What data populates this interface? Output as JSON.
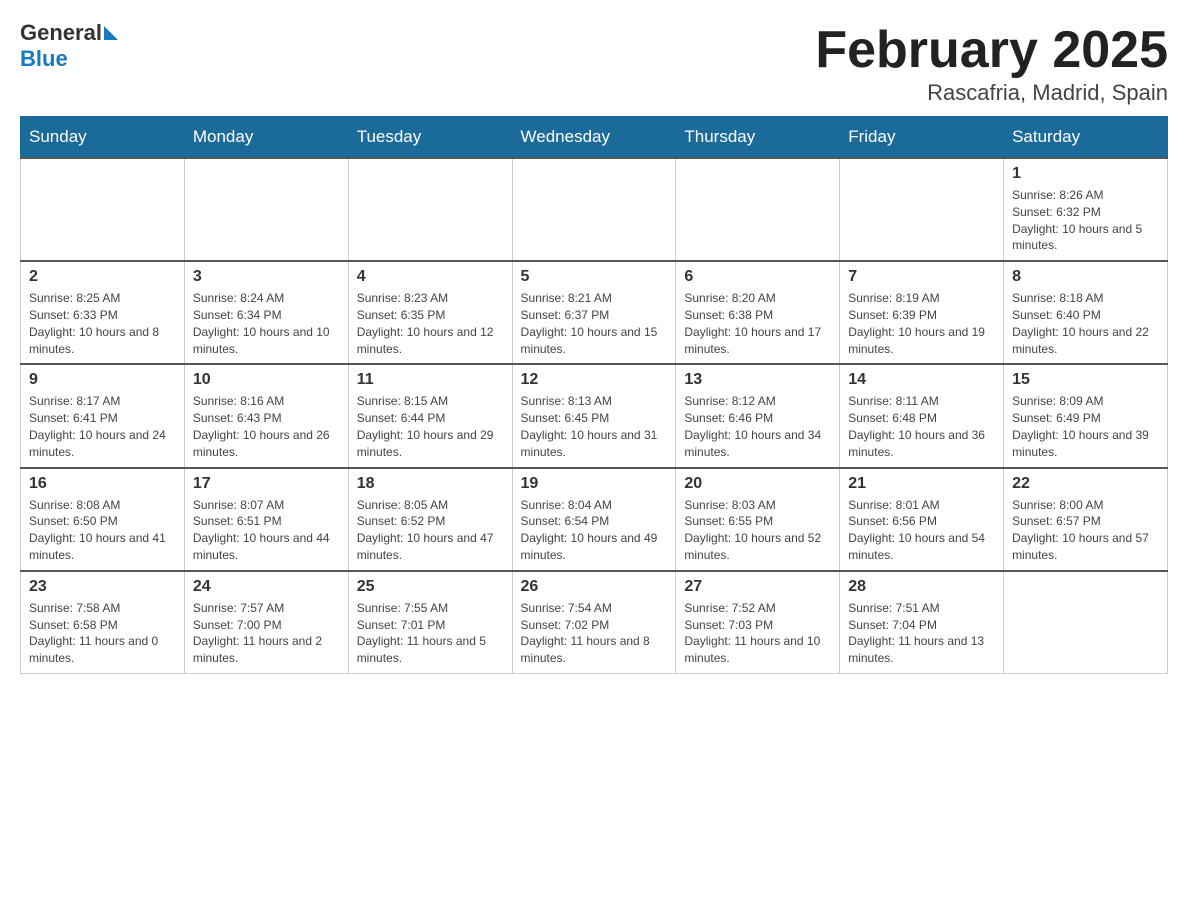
{
  "logo": {
    "general": "General",
    "blue": "Blue"
  },
  "header": {
    "month_year": "February 2025",
    "location": "Rascafria, Madrid, Spain"
  },
  "weekdays": [
    "Sunday",
    "Monday",
    "Tuesday",
    "Wednesday",
    "Thursday",
    "Friday",
    "Saturday"
  ],
  "weeks": [
    [
      {
        "day": "",
        "info": ""
      },
      {
        "day": "",
        "info": ""
      },
      {
        "day": "",
        "info": ""
      },
      {
        "day": "",
        "info": ""
      },
      {
        "day": "",
        "info": ""
      },
      {
        "day": "",
        "info": ""
      },
      {
        "day": "1",
        "info": "Sunrise: 8:26 AM\nSunset: 6:32 PM\nDaylight: 10 hours and 5 minutes."
      }
    ],
    [
      {
        "day": "2",
        "info": "Sunrise: 8:25 AM\nSunset: 6:33 PM\nDaylight: 10 hours and 8 minutes."
      },
      {
        "day": "3",
        "info": "Sunrise: 8:24 AM\nSunset: 6:34 PM\nDaylight: 10 hours and 10 minutes."
      },
      {
        "day": "4",
        "info": "Sunrise: 8:23 AM\nSunset: 6:35 PM\nDaylight: 10 hours and 12 minutes."
      },
      {
        "day": "5",
        "info": "Sunrise: 8:21 AM\nSunset: 6:37 PM\nDaylight: 10 hours and 15 minutes."
      },
      {
        "day": "6",
        "info": "Sunrise: 8:20 AM\nSunset: 6:38 PM\nDaylight: 10 hours and 17 minutes."
      },
      {
        "day": "7",
        "info": "Sunrise: 8:19 AM\nSunset: 6:39 PM\nDaylight: 10 hours and 19 minutes."
      },
      {
        "day": "8",
        "info": "Sunrise: 8:18 AM\nSunset: 6:40 PM\nDaylight: 10 hours and 22 minutes."
      }
    ],
    [
      {
        "day": "9",
        "info": "Sunrise: 8:17 AM\nSunset: 6:41 PM\nDaylight: 10 hours and 24 minutes."
      },
      {
        "day": "10",
        "info": "Sunrise: 8:16 AM\nSunset: 6:43 PM\nDaylight: 10 hours and 26 minutes."
      },
      {
        "day": "11",
        "info": "Sunrise: 8:15 AM\nSunset: 6:44 PM\nDaylight: 10 hours and 29 minutes."
      },
      {
        "day": "12",
        "info": "Sunrise: 8:13 AM\nSunset: 6:45 PM\nDaylight: 10 hours and 31 minutes."
      },
      {
        "day": "13",
        "info": "Sunrise: 8:12 AM\nSunset: 6:46 PM\nDaylight: 10 hours and 34 minutes."
      },
      {
        "day": "14",
        "info": "Sunrise: 8:11 AM\nSunset: 6:48 PM\nDaylight: 10 hours and 36 minutes."
      },
      {
        "day": "15",
        "info": "Sunrise: 8:09 AM\nSunset: 6:49 PM\nDaylight: 10 hours and 39 minutes."
      }
    ],
    [
      {
        "day": "16",
        "info": "Sunrise: 8:08 AM\nSunset: 6:50 PM\nDaylight: 10 hours and 41 minutes."
      },
      {
        "day": "17",
        "info": "Sunrise: 8:07 AM\nSunset: 6:51 PM\nDaylight: 10 hours and 44 minutes."
      },
      {
        "day": "18",
        "info": "Sunrise: 8:05 AM\nSunset: 6:52 PM\nDaylight: 10 hours and 47 minutes."
      },
      {
        "day": "19",
        "info": "Sunrise: 8:04 AM\nSunset: 6:54 PM\nDaylight: 10 hours and 49 minutes."
      },
      {
        "day": "20",
        "info": "Sunrise: 8:03 AM\nSunset: 6:55 PM\nDaylight: 10 hours and 52 minutes."
      },
      {
        "day": "21",
        "info": "Sunrise: 8:01 AM\nSunset: 6:56 PM\nDaylight: 10 hours and 54 minutes."
      },
      {
        "day": "22",
        "info": "Sunrise: 8:00 AM\nSunset: 6:57 PM\nDaylight: 10 hours and 57 minutes."
      }
    ],
    [
      {
        "day": "23",
        "info": "Sunrise: 7:58 AM\nSunset: 6:58 PM\nDaylight: 11 hours and 0 minutes."
      },
      {
        "day": "24",
        "info": "Sunrise: 7:57 AM\nSunset: 7:00 PM\nDaylight: 11 hours and 2 minutes."
      },
      {
        "day": "25",
        "info": "Sunrise: 7:55 AM\nSunset: 7:01 PM\nDaylight: 11 hours and 5 minutes."
      },
      {
        "day": "26",
        "info": "Sunrise: 7:54 AM\nSunset: 7:02 PM\nDaylight: 11 hours and 8 minutes."
      },
      {
        "day": "27",
        "info": "Sunrise: 7:52 AM\nSunset: 7:03 PM\nDaylight: 11 hours and 10 minutes."
      },
      {
        "day": "28",
        "info": "Sunrise: 7:51 AM\nSunset: 7:04 PM\nDaylight: 11 hours and 13 minutes."
      },
      {
        "day": "",
        "info": ""
      }
    ]
  ]
}
